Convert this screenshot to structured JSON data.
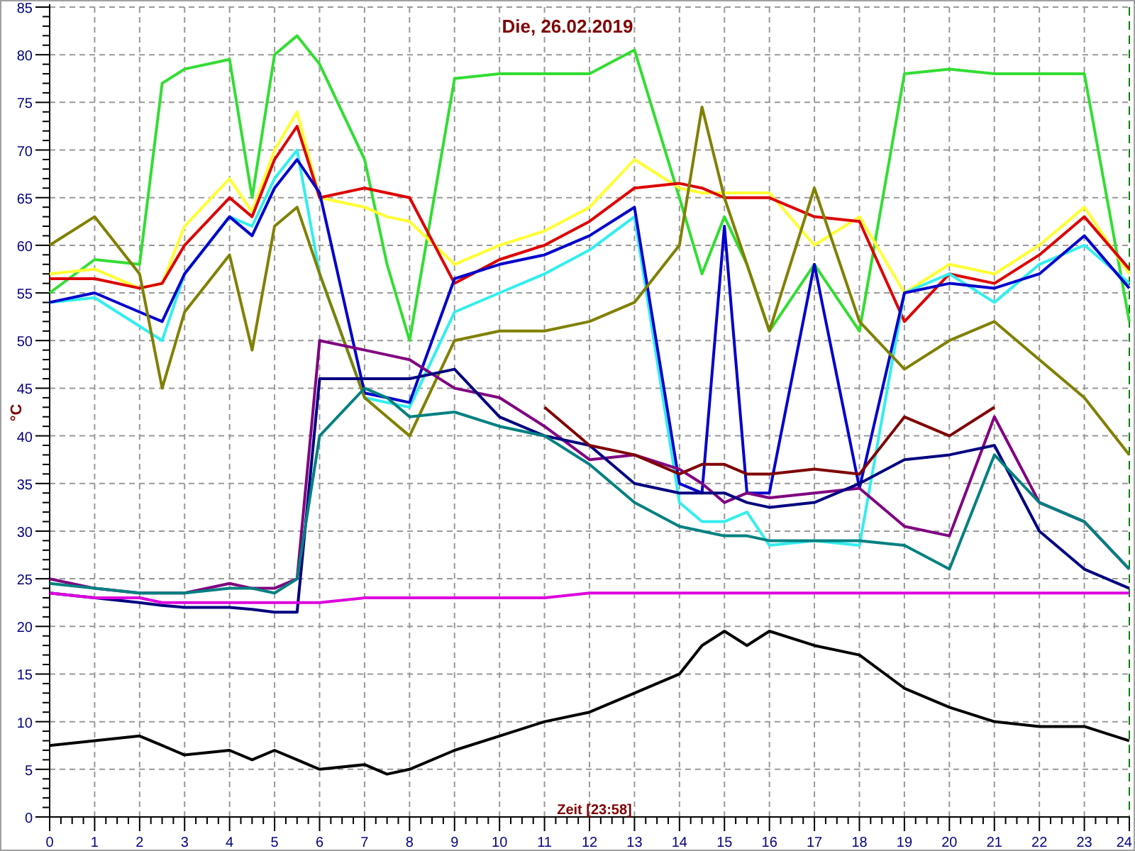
{
  "chart": {
    "chart_data": {
      "type": "line",
      "grid": true,
      "title": "Die, 26.02.2019",
      "xlabel": "Zeit [23:58]",
      "ylabel": "°C",
      "xlim": [
        0,
        24
      ],
      "ylim": [
        0,
        85
      ],
      "xticks": [
        0,
        1,
        2,
        3,
        4,
        5,
        6,
        7,
        8,
        9,
        10,
        11,
        12,
        13,
        14,
        15,
        16,
        17,
        18,
        19,
        20,
        21,
        22,
        23,
        24
      ],
      "yticks": [
        0,
        5,
        10,
        15,
        20,
        25,
        30,
        35,
        40,
        45,
        50,
        55,
        60,
        65,
        70,
        75,
        80,
        85
      ],
      "x": [
        0,
        1,
        2,
        2.5,
        3,
        4,
        4.5,
        5,
        5.5,
        6,
        7,
        7.5,
        8,
        9,
        10,
        11,
        12,
        13,
        14,
        14.5,
        15,
        15.5,
        16,
        17,
        18,
        19,
        20,
        21,
        22,
        23,
        24
      ],
      "series": [
        {
          "color": "#33dd33",
          "values": [
            55,
            58.5,
            58,
            77,
            78.5,
            79.5,
            65,
            80,
            82,
            79,
            69,
            58,
            50,
            77.5,
            78,
            78,
            78,
            80.5,
            65,
            57,
            63,
            58,
            51,
            58,
            51,
            78,
            78.5,
            78,
            78,
            78,
            52
          ]
        },
        {
          "color": "#ffff33",
          "values": [
            57,
            57.5,
            55.5,
            56,
            62,
            67,
            63.5,
            70,
            74,
            65,
            64,
            63,
            62.5,
            58,
            60,
            61.5,
            64,
            69,
            66,
            65.5,
            65.5,
            65.5,
            65.5,
            60,
            63,
            55,
            58,
            57,
            60,
            64,
            57
          ]
        },
        {
          "color": "#dd0000",
          "values": [
            56.5,
            56.5,
            55.5,
            56,
            60,
            65,
            63,
            69,
            72.5,
            65,
            66,
            65.5,
            65,
            56,
            58.5,
            60,
            62.5,
            66,
            66.5,
            66,
            65,
            65,
            65,
            63,
            62.5,
            52,
            57,
            56,
            59,
            63,
            57.5
          ]
        },
        {
          "color": "#33eeee",
          "values": [
            54,
            54.5,
            51.5,
            50,
            57,
            63,
            62,
            67,
            70,
            57,
            44,
            43.5,
            43,
            53,
            55,
            57,
            59.5,
            63,
            33,
            31,
            31,
            32,
            28.5,
            29,
            28.5,
            55,
            57,
            54,
            58,
            60,
            56
          ]
        },
        {
          "color": "#0000cc",
          "values": [
            54,
            55,
            53,
            52,
            57,
            63,
            61,
            66,
            69,
            65.5,
            44.5,
            44,
            43.5,
            56.5,
            58,
            59,
            61,
            64,
            35,
            34,
            62,
            34,
            34,
            58,
            34.5,
            55,
            56,
            55.5,
            57,
            61,
            55.5
          ]
        },
        {
          "color": "#808000",
          "values": [
            60,
            63,
            57,
            45,
            53,
            59,
            49,
            62,
            64,
            57,
            44,
            42,
            40,
            50,
            51,
            51,
            52,
            54,
            60,
            74.5,
            65,
            58,
            51,
            66,
            52,
            47,
            50,
            52,
            48,
            44,
            38
          ]
        },
        {
          "color": "#800080",
          "values": [
            25,
            24,
            23.5,
            23.5,
            23.5,
            24.5,
            24,
            24,
            25,
            50,
            49,
            48.5,
            48,
            45,
            44,
            41,
            37.5,
            38,
            36.5,
            35,
            33,
            34,
            33.5,
            34,
            34.5,
            30.5,
            29.5,
            42,
            33,
            31,
            26
          ]
        },
        {
          "color": "#000080",
          "values": [
            23.5,
            23,
            22.5,
            22.2,
            22,
            22,
            21.8,
            21.5,
            21.5,
            46,
            46,
            46,
            46,
            47,
            42,
            40,
            39,
            35,
            34,
            34,
            34,
            33,
            32.5,
            33,
            35,
            37.5,
            38,
            39,
            30,
            26,
            24
          ]
        },
        {
          "color": "#008080",
          "values": [
            24.5,
            24,
            23.5,
            23.5,
            23.5,
            24,
            24,
            23.5,
            25,
            40,
            45,
            44,
            42,
            42.5,
            41,
            40,
            37,
            33,
            30.5,
            30,
            29.5,
            29.5,
            29,
            29,
            29,
            28.5,
            26,
            38,
            33,
            31,
            26
          ]
        },
        {
          "color": "#800000",
          "values": [
            null,
            null,
            null,
            null,
            null,
            null,
            null,
            null,
            null,
            null,
            null,
            null,
            null,
            null,
            null,
            43,
            39,
            38,
            36,
            37,
            37,
            36,
            36,
            36.5,
            36,
            42,
            40,
            43,
            null,
            null,
            null
          ]
        },
        {
          "color": "#dd00dd",
          "values": [
            23.5,
            23,
            23,
            22.5,
            22.5,
            22.5,
            22.5,
            22.5,
            22.5,
            22.5,
            23,
            23,
            23,
            23,
            23,
            23,
            23.5,
            23.5,
            23.5,
            23.5,
            23.5,
            23.5,
            23.5,
            23.5,
            23.5,
            23.5,
            23.5,
            23.5,
            23.5,
            23.5,
            23.5
          ]
        },
        {
          "color": "#000000",
          "values": [
            7.5,
            8,
            8.5,
            7.5,
            6.5,
            7,
            6,
            7,
            6,
            5,
            5.5,
            4.5,
            5,
            7,
            8.5,
            10,
            11,
            13,
            15,
            18,
            19.5,
            18,
            19.5,
            18,
            17,
            13.5,
            11.5,
            10,
            9.5,
            9.5,
            8
          ]
        }
      ]
    }
  }
}
